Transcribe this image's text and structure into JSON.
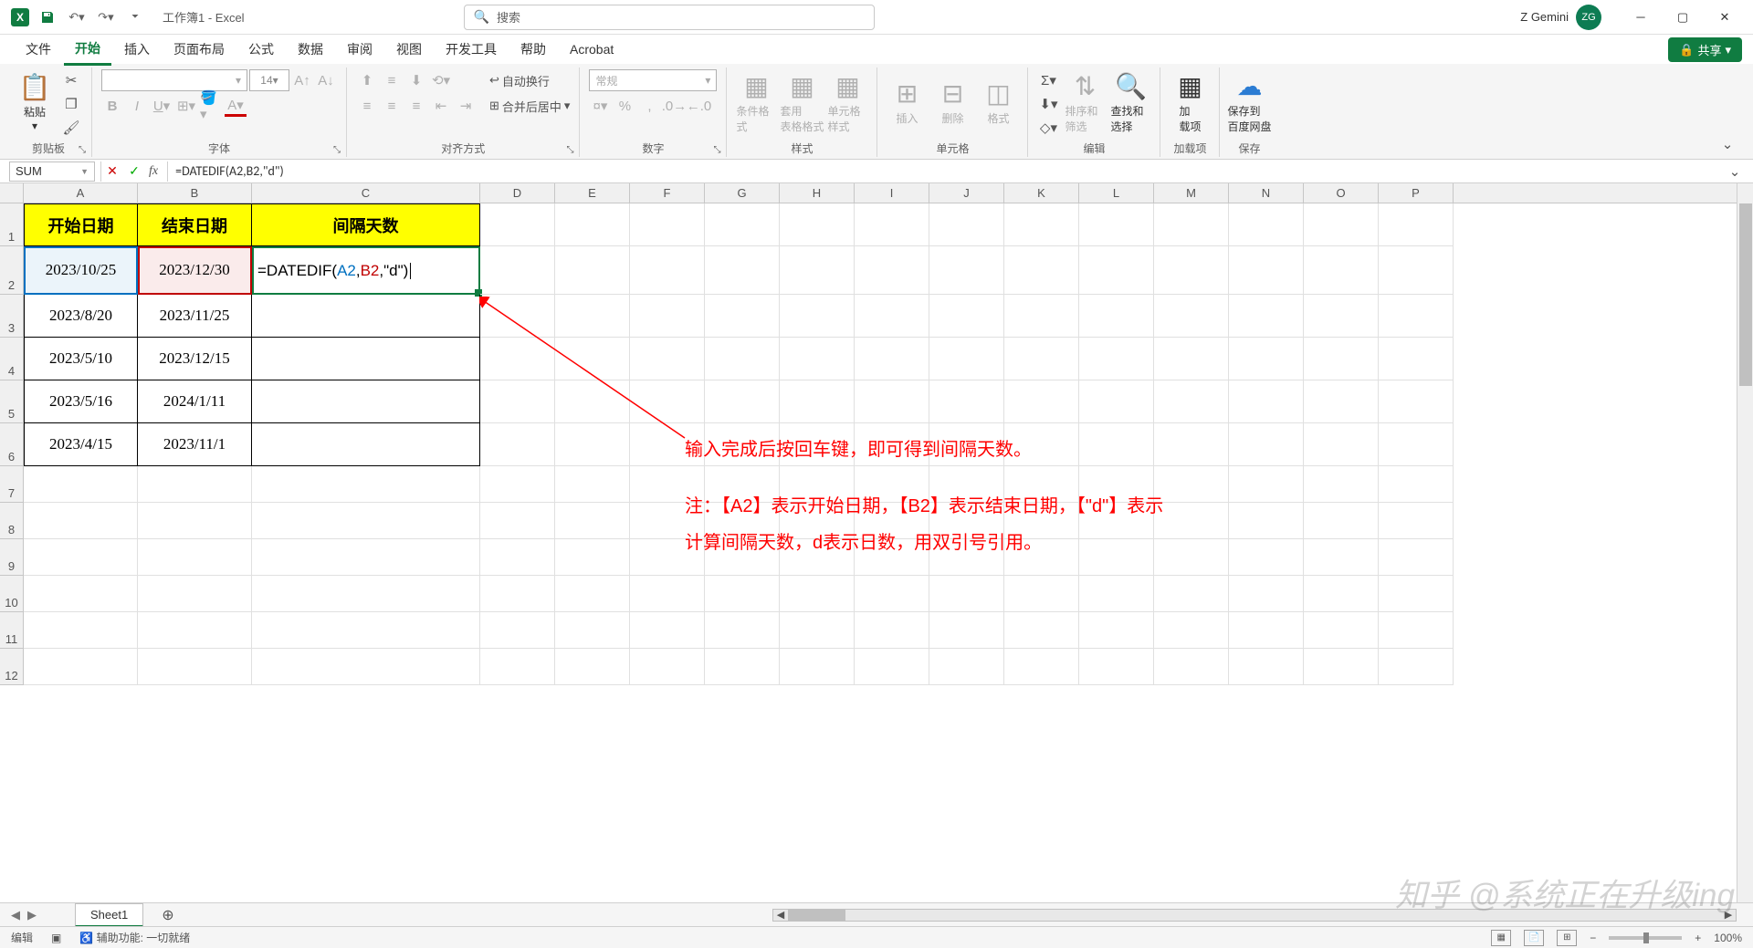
{
  "title": "工作簿1 - Excel",
  "search_placeholder": "搜索",
  "user": {
    "name": "Z Gemini",
    "initials": "ZG"
  },
  "tabs": [
    "文件",
    "开始",
    "插入",
    "页面布局",
    "公式",
    "数据",
    "审阅",
    "视图",
    "开发工具",
    "帮助",
    "Acrobat"
  ],
  "share_label": "共享",
  "ribbon": {
    "clipboard": {
      "paste": "粘贴",
      "label": "剪贴板"
    },
    "font": {
      "size": "14",
      "label": "字体"
    },
    "alignment": {
      "wrap": "自动换行",
      "merge": "合并后居中",
      "label": "对齐方式"
    },
    "number": {
      "format": "常规",
      "label": "数字"
    },
    "styles": {
      "cond": "条件格式",
      "table": "套用\n表格格式",
      "cell": "单元格样式",
      "label": "样式"
    },
    "cells": {
      "insert": "插入",
      "delete": "删除",
      "format": "格式",
      "label": "单元格"
    },
    "editing": {
      "sort": "排序和筛选",
      "find": "查找和选择",
      "label": "编辑"
    },
    "addins": {
      "addin": "加\n载项",
      "label": "加载项"
    },
    "save": {
      "btn": "保存到\n百度网盘",
      "label": "保存"
    }
  },
  "name_box": "SUM",
  "formula": "=DATEDIF(A2,B2,\"d\")",
  "headers": {
    "a": "开始日期",
    "b": "结束日期",
    "c": "间隔天数"
  },
  "data_rows": [
    {
      "a": "2023/10/25",
      "b": "2023/12/30"
    },
    {
      "a": "2023/8/20",
      "b": "2023/11/25"
    },
    {
      "a": "2023/5/10",
      "b": "2023/12/15"
    },
    {
      "a": "2023/5/16",
      "b": "2024/1/11"
    },
    {
      "a": "2023/4/15",
      "b": "2023/11/1"
    }
  ],
  "edit_cell_parts": {
    "pre": "=DATEDIF(",
    "a2": "A2",
    "c1": ",",
    "b2": "B2",
    "c2": ",",
    "d": "\"d\"",
    "post": ")"
  },
  "column_letters": [
    "A",
    "B",
    "C",
    "D",
    "E",
    "F",
    "G",
    "H",
    "I",
    "J",
    "K",
    "L",
    "M",
    "N",
    "O",
    "P"
  ],
  "annotations": {
    "l1": "输入完成后按回车键，即可得到间隔天数。",
    "l2": "注：【A2】表示开始日期，【B2】表示结束日期，【\"d\"】表示",
    "l3": "计算间隔天数，d表示日数，用双引号引用。"
  },
  "watermark": "知乎 @系统正在升级ing",
  "sheet_tab": "Sheet1",
  "status": {
    "mode": "编辑",
    "acc": "辅助功能: 一切就绪",
    "zoom": "100%"
  }
}
